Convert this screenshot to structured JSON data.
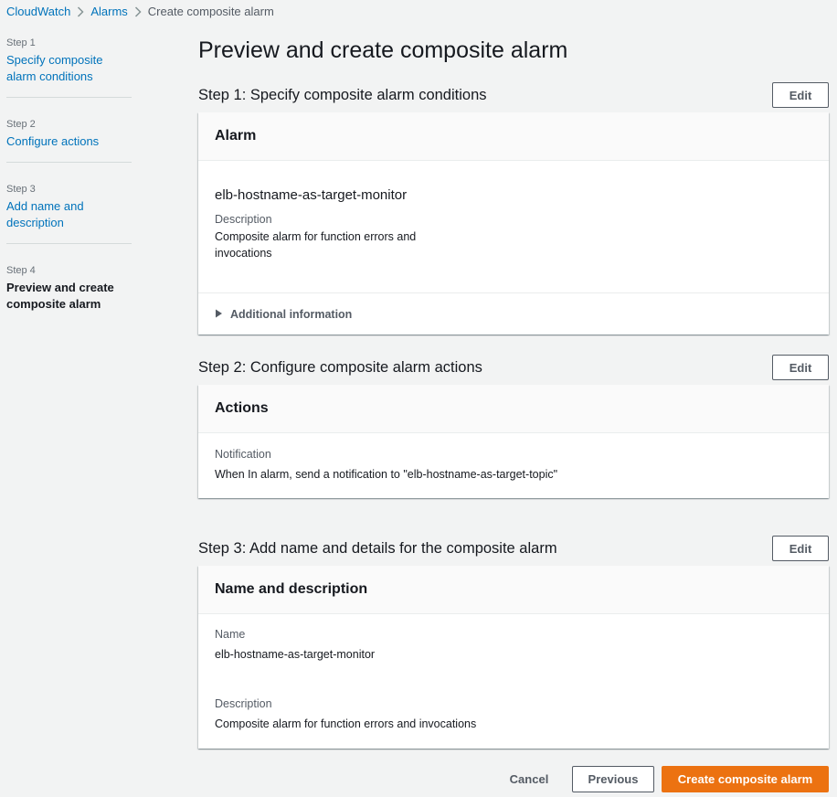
{
  "breadcrumb": {
    "items": [
      "CloudWatch",
      "Alarms",
      "Create composite alarm"
    ]
  },
  "steps": [
    {
      "num": "Step 1",
      "title": "Specify composite alarm conditions"
    },
    {
      "num": "Step 2",
      "title": "Configure actions"
    },
    {
      "num": "Step 3",
      "title": "Add name and description"
    },
    {
      "num": "Step 4",
      "title": "Preview and create composite alarm"
    }
  ],
  "page": {
    "title": "Preview and create composite alarm"
  },
  "section1": {
    "heading": "Step 1: Specify composite alarm conditions",
    "edit_label": "Edit",
    "card_title": "Alarm",
    "alarm_name": "elb-hostname-as-target-monitor",
    "description_label": "Description",
    "description_value": "Composite alarm for function errors and invocations",
    "additional_info_label": "Additional information"
  },
  "section2": {
    "heading": "Step 2: Configure composite alarm actions",
    "edit_label": "Edit",
    "card_title": "Actions",
    "notification_label": "Notification",
    "notification_value": "When In alarm, send a notification to \"elb-hostname-as-target-topic\""
  },
  "section3": {
    "heading": "Step 3: Add name and details for the composite alarm",
    "edit_label": "Edit",
    "card_title": "Name and description",
    "name_label": "Name",
    "name_value": "elb-hostname-as-target-monitor",
    "description_label": "Description",
    "description_value": "Composite alarm for function errors and invocations"
  },
  "footer": {
    "cancel_label": "Cancel",
    "previous_label": "Previous",
    "create_label": "Create composite alarm"
  },
  "colors": {
    "link": "#0073bb",
    "primary_button": "#ec7211",
    "background": "#f2f3f3"
  }
}
